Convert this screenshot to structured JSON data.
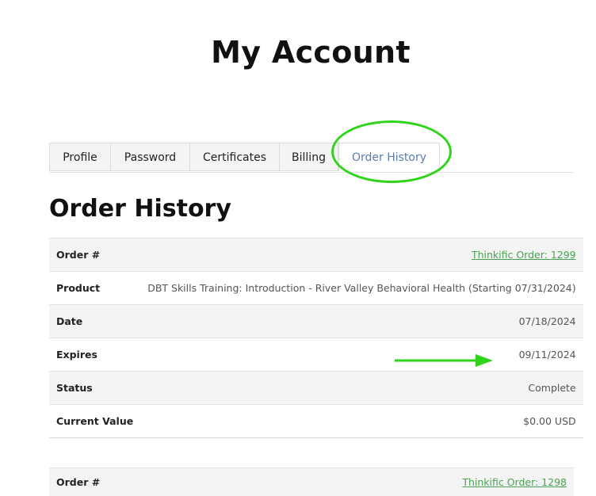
{
  "page": {
    "title": "My Account"
  },
  "tabs": [
    {
      "label": "Profile",
      "active": false
    },
    {
      "label": "Password",
      "active": false
    },
    {
      "label": "Certificates",
      "active": false
    },
    {
      "label": "Billing",
      "active": false
    },
    {
      "label": "Order History",
      "active": true
    }
  ],
  "section": {
    "title": "Order History"
  },
  "orders": [
    {
      "rows": [
        {
          "key": "Order #",
          "value": "Thinkific Order: 1299"
        },
        {
          "key": "Product",
          "value": "DBT Skills Training: Introduction - River Valley Behavioral Health (Starting 07/31/2024)"
        },
        {
          "key": "Date",
          "value": "07/18/2024"
        },
        {
          "key": "Expires",
          "value": "09/11/2024"
        },
        {
          "key": "Status",
          "value": "Complete"
        },
        {
          "key": "Current Value",
          "value": "$0.00 USD"
        }
      ]
    },
    {
      "rows": [
        {
          "key": "Order #",
          "value": "Thinkific Order: 1298"
        }
      ]
    }
  ],
  "annotation_colors": {
    "highlight": "#2fd41b"
  }
}
